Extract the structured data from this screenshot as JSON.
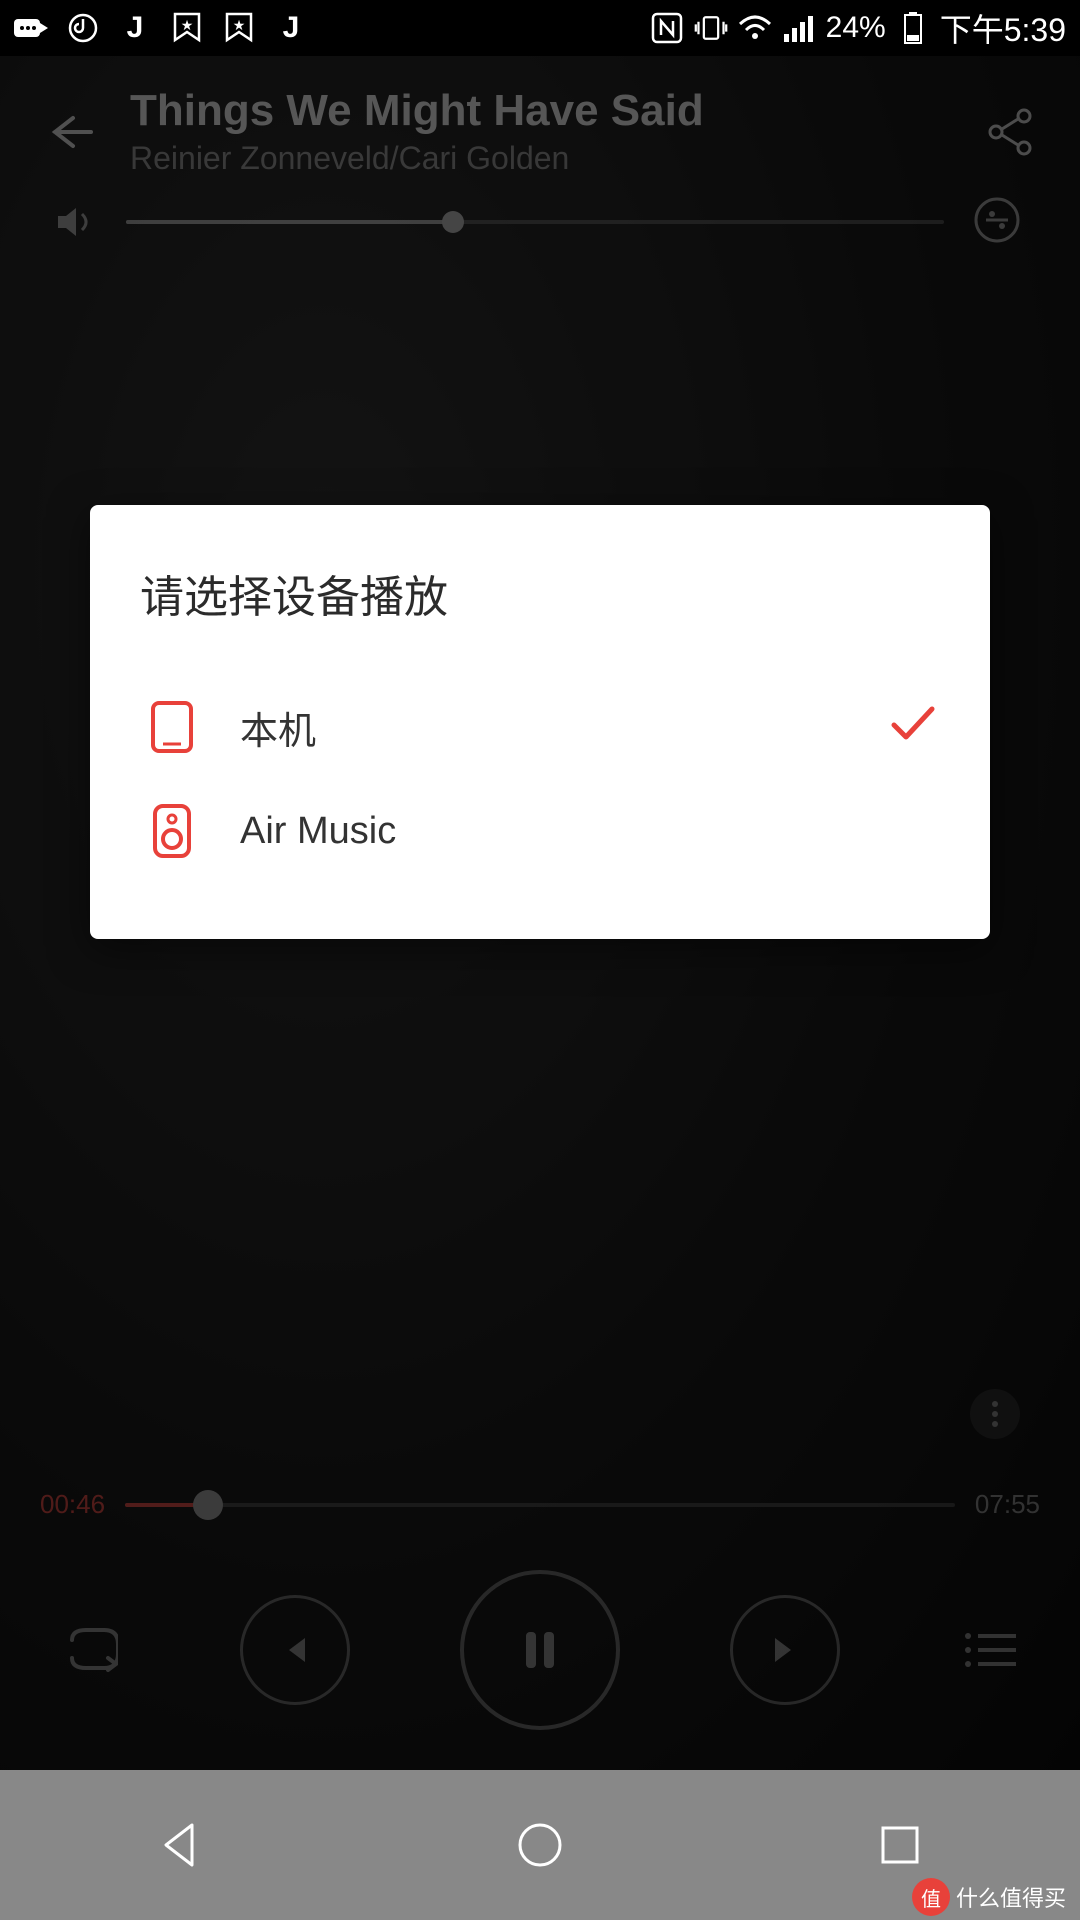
{
  "status": {
    "battery_pct": "24%",
    "time": "下午5:39"
  },
  "player": {
    "title": "Things We Might Have Said",
    "artist": "Reinier Zonneveld/Cari Golden",
    "current_time": "00:46",
    "total_time": "07:55"
  },
  "modal": {
    "title": "请选择设备播放",
    "devices": [
      {
        "label": "本机",
        "selected": true
      },
      {
        "label": "Air Music",
        "selected": false
      }
    ]
  },
  "watermark": "什么值得买"
}
